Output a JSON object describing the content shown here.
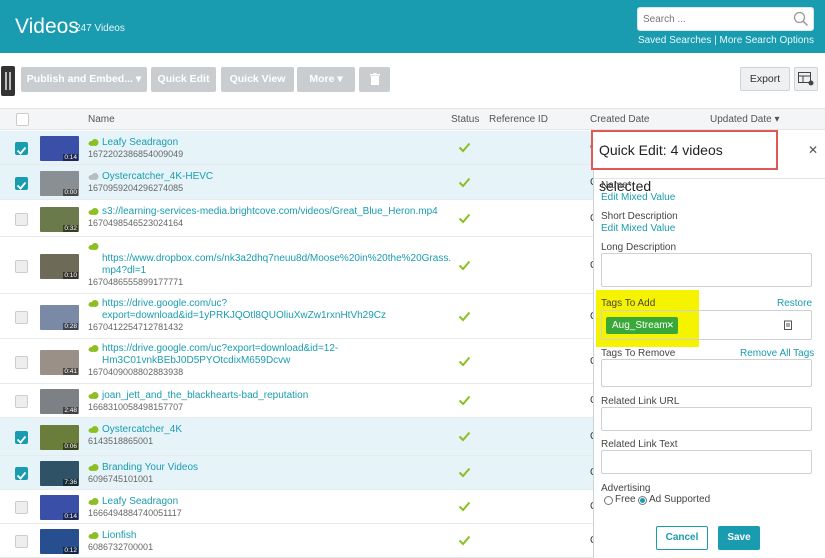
{
  "header": {
    "title": "Videos",
    "count": "247 Videos",
    "search_placeholder": "Search ...",
    "saved_searches": "Saved Searches",
    "separator": " | ",
    "more_options": "More Search Options"
  },
  "toolbar": {
    "publish": "Publish and Embed...",
    "quick_edit": "Quick Edit",
    "quick_view": "Quick View",
    "more": "More",
    "export": "Export"
  },
  "table": {
    "headers": {
      "name": "Name",
      "status": "Status",
      "reference_id": "Reference ID",
      "created_date": "Created Date",
      "updated_date": "Updated Date ▾"
    }
  },
  "rows": [
    {
      "title": "Leafy Seadragon",
      "id": "1672202386854009049",
      "duration": "0:14",
      "selected": true,
      "created": "C"
    },
    {
      "title": "Oystercatcher_4K-HEVC",
      "id": "1670959204296274085",
      "duration": "0:00",
      "selected": true,
      "created": "C"
    },
    {
      "title": "s3://learning-services-media.brightcove.com/videos/Great_Blue_Heron.mp4",
      "id": "1670498546523024164",
      "duration": "0:32",
      "selected": false,
      "created": "C"
    },
    {
      "title": "\nhttps://www.dropbox.com/s/nk3a2dhq7neuu8d/Moose%20in%20the%20Grass.\nmp4?dl=1",
      "id": "1670486555899177771",
      "duration": "0:10",
      "selected": false,
      "created": "C"
    },
    {
      "title": "https://drive.google.com/uc?\nexport=download&id=1yPRKJQOtl8QUOliuXwZw1rxnHtVh29Cz",
      "id": "1670412254712781432",
      "duration": "0:28",
      "selected": false,
      "created": "C"
    },
    {
      "title": "https://drive.google.com/uc?export=download&id=12-\nHm3C01vnkBEbJ0D5PYOtcdixM659Dcvw",
      "id": "1670409008802883938",
      "duration": "0:41",
      "selected": false,
      "created": "C"
    },
    {
      "title": "joan_jett_and_the_blackhearts-bad_reputation",
      "id": "1668310058498157707",
      "duration": "2:48",
      "selected": false,
      "created": "C"
    },
    {
      "title": "Oystercatcher_4K",
      "id": "6143518865001",
      "duration": "0:06",
      "selected": true,
      "created": "C"
    },
    {
      "title": "Branding Your Videos",
      "id": "6096745101001",
      "duration": "7:36",
      "selected": true,
      "created": "C"
    },
    {
      "title": "Leafy Seadragon",
      "id": "1666494884740051117",
      "duration": "0:14",
      "selected": false,
      "created": "C"
    },
    {
      "title": "Lionfish",
      "id": "6086732700001",
      "duration": "0:12",
      "selected": false,
      "created": "C"
    }
  ],
  "panel": {
    "title": "Quick Edit: 4 videos selected",
    "name_label": "Name*",
    "name_link": "Edit Mixed Value",
    "short_desc_label": "Short Description",
    "short_desc_link": "Edit Mixed Value",
    "long_desc_label": "Long Description",
    "tags_add_label": "Tags To Add",
    "restore": "Restore",
    "tag": "Aug_Stream",
    "tags_remove_label": "Tags To Remove",
    "remove_all": "Remove All Tags",
    "related_url_label": "Related Link URL",
    "related_text_label": "Related Link Text",
    "advertising_label": "Advertising",
    "free": "Free",
    "ad_supported": "Ad Supported",
    "cancel": "Cancel",
    "save": "Save"
  },
  "colors": {
    "accent": "#1a9cb0",
    "highlight": "#f6f300",
    "tag": "#39a839",
    "status_ok": "#8bbf23"
  }
}
